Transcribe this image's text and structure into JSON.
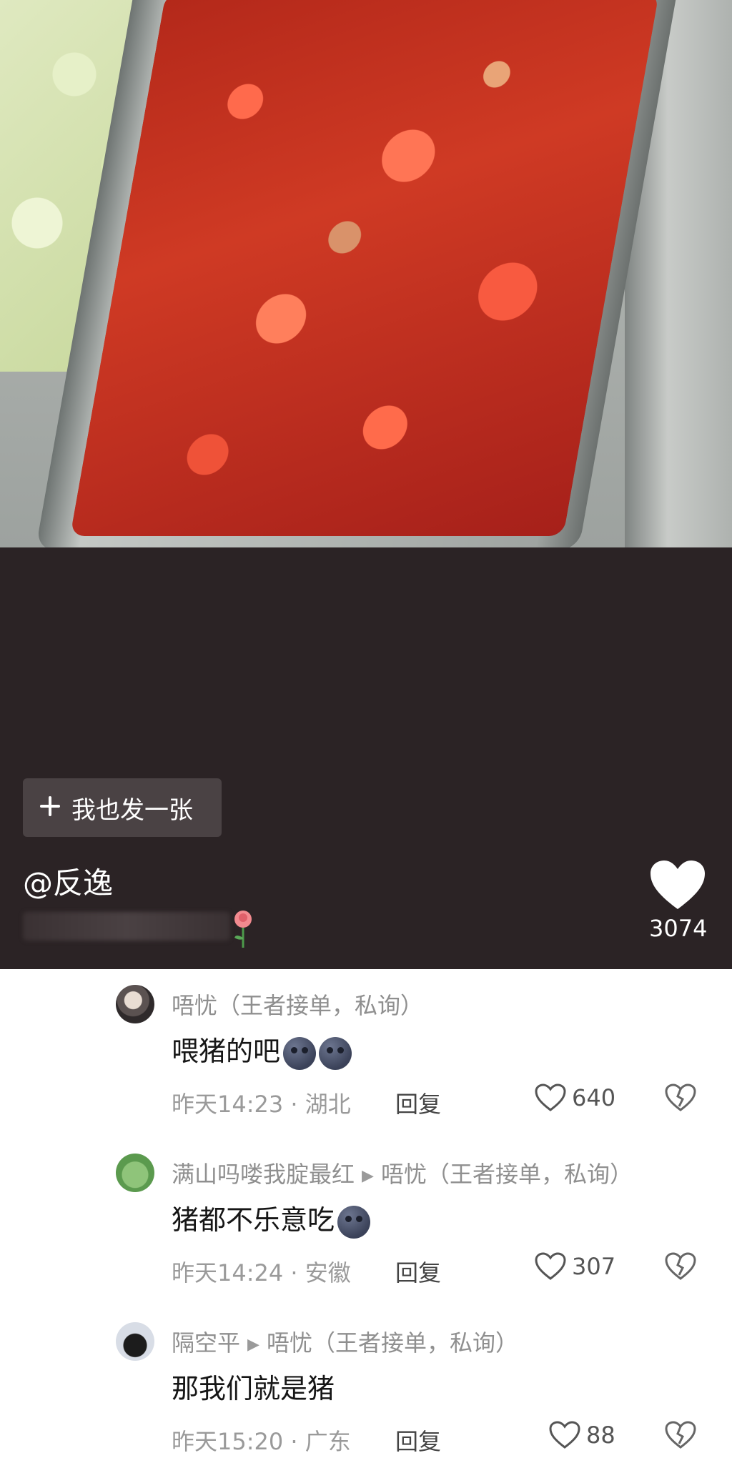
{
  "post": {
    "button_label": "我也发一张",
    "button_icon": "plus-icon",
    "author": "@反逸",
    "like_count": "3074"
  },
  "comments": [
    {
      "name": "唔忧（王者接单，私询）",
      "reply_to": "",
      "text": "喂猪的吧",
      "emoji_count": 2,
      "time": "昨天14:23",
      "location": "湖北",
      "reply_label": "回复",
      "likes": "640"
    },
    {
      "name": "满山吗喽我腚最红",
      "reply_to": "唔忧（王者接单，私询）",
      "text": "猪都不乐意吃",
      "emoji_count": 1,
      "time": "昨天14:24",
      "location": "安徽",
      "reply_label": "回复",
      "likes": "307"
    },
    {
      "name": "隔空平",
      "reply_to": "唔忧（王者接单，私询）",
      "text": "那我们就是猪",
      "emoji_count": 0,
      "time": "昨天15:20",
      "location": "广东",
      "reply_label": "回复",
      "likes": "88"
    }
  ],
  "meta_separator": "·",
  "colors": {
    "dark_background": "#2b2325",
    "button_background": "#4a4244",
    "name_gray": "#8f8f8f"
  }
}
